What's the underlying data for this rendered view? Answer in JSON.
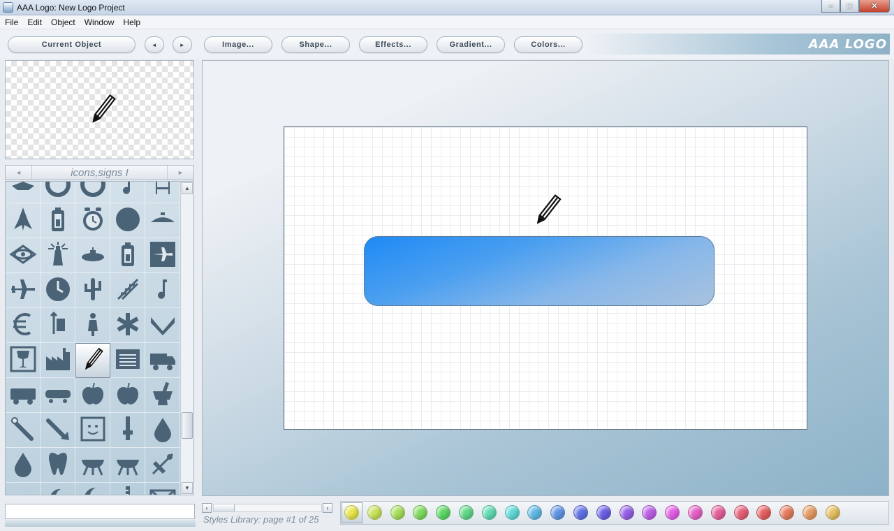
{
  "window": {
    "title": "AAA Logo: New Logo Project",
    "controls": {
      "minimize": "–",
      "maximize": "□",
      "close": "✕"
    }
  },
  "menu": [
    "File",
    "Edit",
    "Object",
    "Window",
    "Help"
  ],
  "toolbar": {
    "current_object": "Current Object",
    "prev": "◄",
    "next": "►",
    "image": "Image...",
    "shape": "Shape...",
    "effects": "Effects...",
    "gradient": "Gradient...",
    "colors": "Colors...",
    "brand": "AAA LOGO"
  },
  "library": {
    "title": "icons,signs I",
    "prev": "◄",
    "next": "►",
    "selected_icon": "pencil-icon",
    "icons": [
      "partial-shape-icon",
      "ring-icon",
      "ring-icon",
      "music-note-icon",
      "stand-icon",
      "rocket-icon",
      "battery-icon",
      "alarm-clock-icon",
      "circle-icon",
      "boat-hull-icon",
      "eye-diamond-icon",
      "lighthouse-icon",
      "submarine-icon",
      "battery-icon",
      "airplane-badge-icon",
      "airplane-icon",
      "clock-face-icon",
      "cactus-icon",
      "staircase-icon",
      "music-note-icon",
      "euro-icon",
      "stroller-icon",
      "person-icon",
      "asterisk-icon",
      "check-chevron-icon",
      "fragile-glass-icon",
      "factory-icon",
      "pencil-icon",
      "notepad-icon",
      "truck-icon",
      "fire-truck-icon",
      "train-icon",
      "apple-icon",
      "apple-icon",
      "mortar-pestle-icon",
      "slash-tool-icon",
      "arrow-tool-icon",
      "face-icon",
      "brush-icon",
      "water-drop-icon",
      "water-drop-icon",
      "tooth-icon",
      "grill-icon",
      "grill-icon",
      "satellite-icon",
      "wave-icon",
      "moon-star-icon",
      "crescent-icon",
      "ruler-icon",
      "envelope-icon"
    ]
  },
  "canvas": {
    "shape_gradient": [
      "#1e8af5",
      "#a9c2de"
    ],
    "icon": "pencil-icon"
  },
  "styles": {
    "label": "Styles Library: page #1 of 25",
    "swatches": [
      "#e9e64a",
      "#c8e35a",
      "#a6df5a",
      "#7fdc5f",
      "#5cd865",
      "#5fd889",
      "#5fdbb2",
      "#5fd9d8",
      "#5fb9e6",
      "#5f95e6",
      "#5f72e6",
      "#6b5fe6",
      "#955fe6",
      "#bd5fe6",
      "#e35fe6",
      "#e65fc6",
      "#e65f9a",
      "#e65f78",
      "#e65f5f",
      "#e67c5f",
      "#e69a5f",
      "#e6bf5f"
    ]
  }
}
